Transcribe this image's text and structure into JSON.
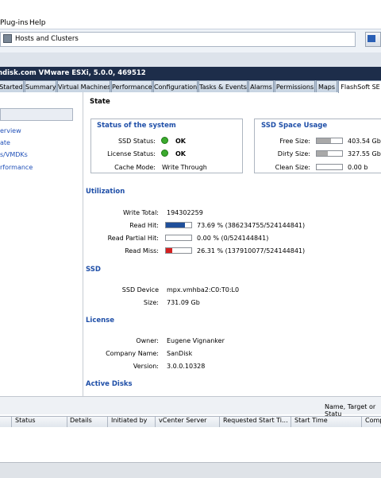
{
  "menubar": {
    "items": [
      "Plug-ins",
      "Help"
    ]
  },
  "navbar": {
    "location": "Hosts and Clusters"
  },
  "host": {
    "title": "ndisk.com VMware ESXi, 5.0.0, 469512"
  },
  "tabs": [
    {
      "label": "Started"
    },
    {
      "label": "Summary"
    },
    {
      "label": "Virtual Machines"
    },
    {
      "label": "Performance"
    },
    {
      "label": "Configuration"
    },
    {
      "label": "Tasks & Events"
    },
    {
      "label": "Alarms"
    },
    {
      "label": "Permissions"
    },
    {
      "label": "Maps"
    },
    {
      "label": "FlashSoft SE"
    }
  ],
  "left_nav": {
    "items": [
      "erview",
      "ate",
      "s/VMDKs",
      "rformance"
    ]
  },
  "state": {
    "title": "State",
    "status_box": {
      "title": "Status of the system",
      "ssd_status_label": "SSD Status:",
      "ssd_status_value": "OK",
      "license_status_label": "License Status:",
      "license_status_value": "OK",
      "cache_mode_label": "Cache Mode:",
      "cache_mode_value": "Write Through"
    },
    "space_box": {
      "title": "SSD Space Usage",
      "free_label": "Free Size:",
      "free_value": "403.54 Gb",
      "free_fraction": 0.55,
      "dirty_label": "Dirty Size:",
      "dirty_value": "327.55 Gb",
      "dirty_fraction": 0.45,
      "clean_label": "Clean Size:",
      "clean_value": "0.00 b",
      "clean_fraction": 0
    }
  },
  "utilization": {
    "title": "Utilization",
    "write_total_label": "Write Total:",
    "write_total_value": "194302259",
    "read_hit_label": "Read Hit:",
    "read_hit_value": "73.69 % (386234755/524144841)",
    "read_hit_fraction": 0.7369,
    "read_partial_label": "Read Partial Hit:",
    "read_partial_value": "0.00 % (0/524144841)",
    "read_partial_fraction": 0,
    "read_miss_label": "Read Miss:",
    "read_miss_value": "26.31 % (137910077/524144841)",
    "read_miss_fraction": 0.2631,
    "colors": {
      "read_hit": "#1f4f9a",
      "read_miss": "#d42020",
      "space": "#a9a9a9"
    }
  },
  "ssd": {
    "title": "SSD",
    "device_label": "SSD Device",
    "device_value": "mpx.vmhba2:C0:T0:L0",
    "size_label": "Size:",
    "size_value": "731.09 Gb"
  },
  "license": {
    "title": "License",
    "owner_label": "Owner:",
    "owner_value": "Eugene Vignanker",
    "company_label": "Company Name:",
    "company_value": "SanDisk",
    "version_label": "Version:",
    "version_value": "3.0.0.10328"
  },
  "active_disks": {
    "title": "Active Disks"
  },
  "tasks": {
    "filter_text": "Name, Target or Statu",
    "columns": [
      "Status",
      "Details",
      "Initiated by",
      "vCenter Server",
      "Requested Start Ti...",
      "Start Time",
      "Comp"
    ]
  }
}
